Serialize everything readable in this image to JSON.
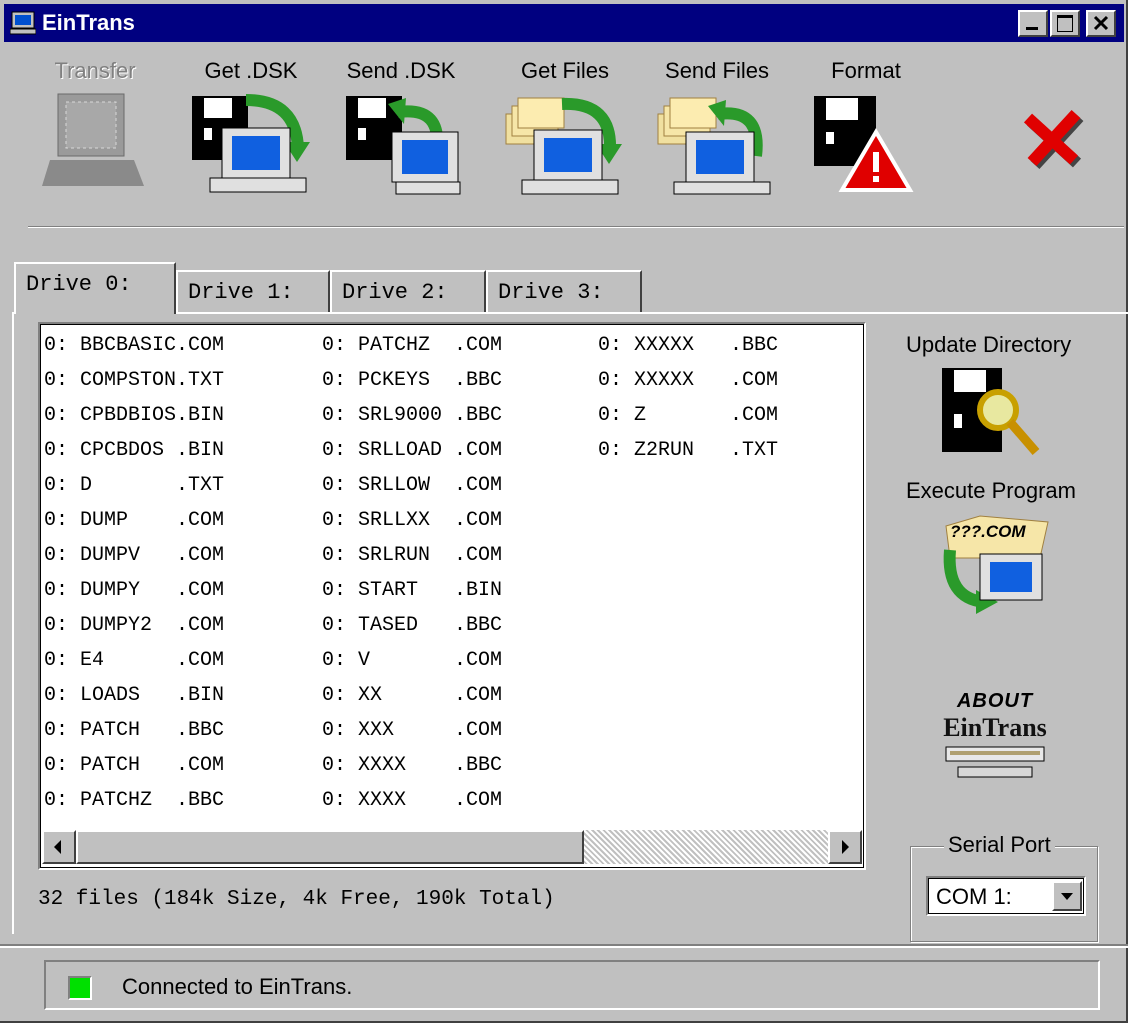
{
  "window": {
    "title": "EinTrans"
  },
  "toolbar": {
    "transfer": "Transfer",
    "get_dsk": "Get .DSK",
    "send_dsk": "Send .DSK",
    "get_files": "Get Files",
    "send_files": "Send Files",
    "format": "Format"
  },
  "tabs": [
    {
      "label": "Drive 0:",
      "active": true
    },
    {
      "label": "Drive 1:",
      "active": false
    },
    {
      "label": "Drive 2:",
      "active": false
    },
    {
      "label": "Drive 3:",
      "active": false
    }
  ],
  "files": {
    "col1": [
      "0: BBCBASIC.COM",
      "0: COMPSTON.TXT",
      "0: CPBDBIOS.BIN",
      "0: CPCBDOS .BIN",
      "0: D       .TXT",
      "0: DUMP    .COM",
      "0: DUMPV   .COM",
      "0: DUMPY   .COM",
      "0: DUMPY2  .COM",
      "0: E4      .COM",
      "0: LOADS   .BIN",
      "0: PATCH   .BBC",
      "0: PATCH   .COM",
      "0: PATCHZ  .BBC"
    ],
    "col2": [
      "0: PATCHZ  .COM",
      "0: PCKEYS  .BBC",
      "0: SRL9000 .BBC",
      "0: SRLLOAD .COM",
      "0: SRLLOW  .COM",
      "0: SRLLXX  .COM",
      "0: SRLRUN  .COM",
      "0: START   .BIN",
      "0: TASED   .BBC",
      "0: V       .COM",
      "0: XX      .COM",
      "0: XXX     .COM",
      "0: XXXX    .BBC",
      "0: XXXX    .COM"
    ],
    "col3": [
      "0: XXXXX   .BBC",
      "0: XXXXX   .COM",
      "0: Z       .COM",
      "0: Z2RUN   .TXT"
    ]
  },
  "file_summary": "32 files (184k Size, 4k Free, 190k Total)",
  "side": {
    "update_directory": "Update Directory",
    "execute_program": "Execute Program",
    "execute_icon_text": "???.COM",
    "about_line1": "ABOUT",
    "about_line2": "EinTrans"
  },
  "serial_port": {
    "label": "Serial Port",
    "value": "COM 1:"
  },
  "status": {
    "text": "Connected to EinTrans.",
    "led_color": "#00e000"
  },
  "colors": {
    "titlebar": "#000080",
    "face": "#c0c0c0"
  }
}
